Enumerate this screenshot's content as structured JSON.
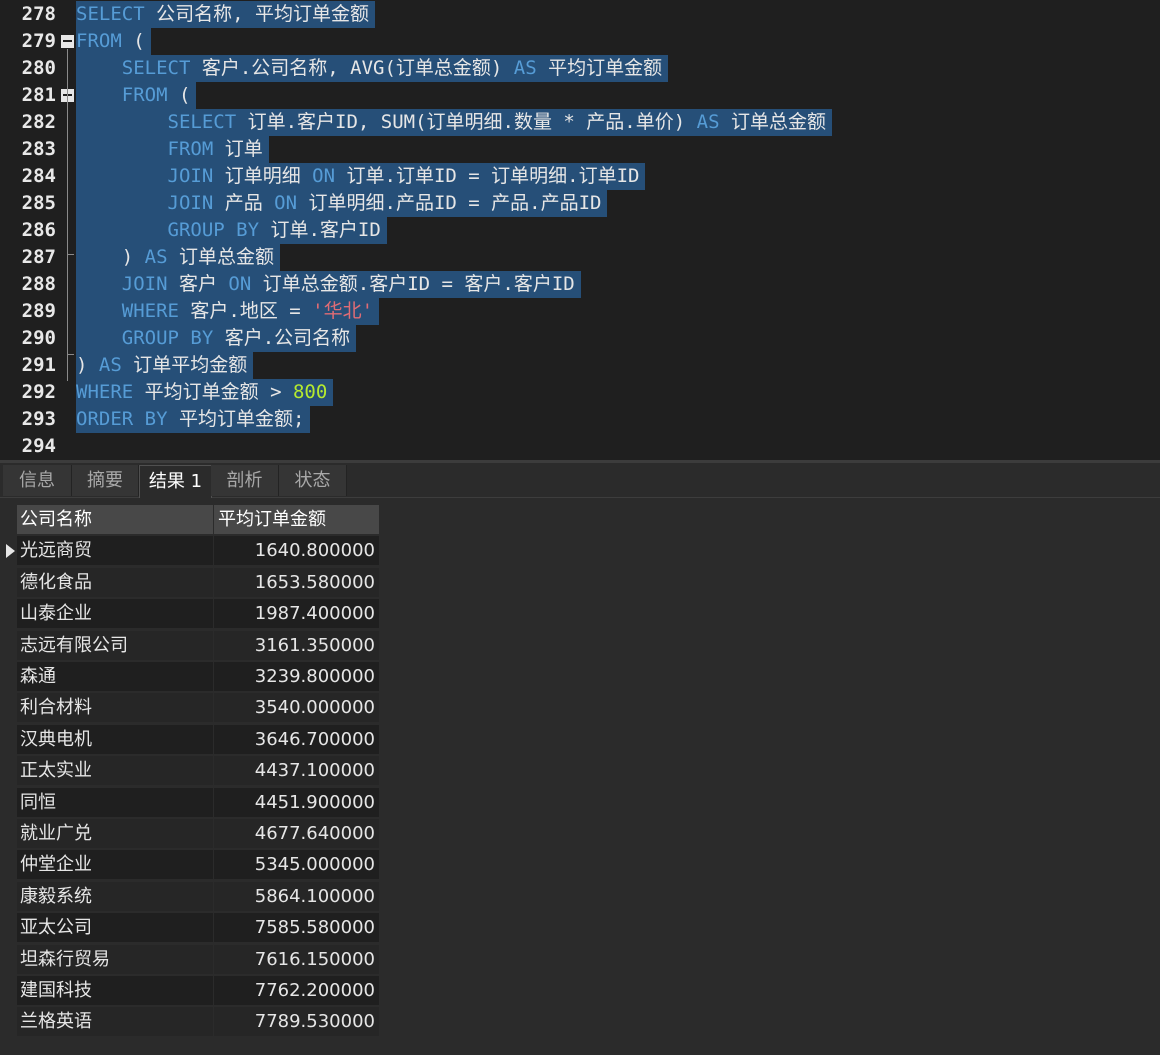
{
  "editor": {
    "lines": [
      {
        "num": "278",
        "tokens": [
          [
            "kw",
            "SELECT"
          ],
          [
            "t",
            " 公司名称, 平均订单金额"
          ]
        ]
      },
      {
        "num": "279",
        "tokens": [
          [
            "kw",
            "FROM"
          ],
          [
            "t",
            " ("
          ]
        ]
      },
      {
        "num": "280",
        "tokens": [
          [
            "t",
            "    "
          ],
          [
            "kw",
            "SELECT"
          ],
          [
            "t",
            " 客户.公司名称, AVG(订单总金额) "
          ],
          [
            "kw",
            "AS"
          ],
          [
            "t",
            " 平均订单金额"
          ]
        ]
      },
      {
        "num": "281",
        "tokens": [
          [
            "t",
            "    "
          ],
          [
            "kw",
            "FROM"
          ],
          [
            "t",
            " ("
          ]
        ]
      },
      {
        "num": "282",
        "tokens": [
          [
            "t",
            "        "
          ],
          [
            "kw",
            "SELECT"
          ],
          [
            "t",
            " 订单.客户ID, SUM(订单明细.数量 * 产品.单价) "
          ],
          [
            "kw",
            "AS"
          ],
          [
            "t",
            " 订单总金额"
          ]
        ]
      },
      {
        "num": "283",
        "tokens": [
          [
            "t",
            "        "
          ],
          [
            "kw",
            "FROM"
          ],
          [
            "t",
            " 订单"
          ]
        ]
      },
      {
        "num": "284",
        "tokens": [
          [
            "t",
            "        "
          ],
          [
            "kw",
            "JOIN"
          ],
          [
            "t",
            " 订单明细 "
          ],
          [
            "kw",
            "ON"
          ],
          [
            "t",
            " 订单.订单ID = 订单明细.订单ID"
          ]
        ]
      },
      {
        "num": "285",
        "tokens": [
          [
            "t",
            "        "
          ],
          [
            "kw",
            "JOIN"
          ],
          [
            "t",
            " 产品 "
          ],
          [
            "kw",
            "ON"
          ],
          [
            "t",
            " 订单明细.产品ID = 产品.产品ID"
          ]
        ]
      },
      {
        "num": "286",
        "tokens": [
          [
            "t",
            "        "
          ],
          [
            "kw",
            "GROUP BY"
          ],
          [
            "t",
            " 订单.客户ID"
          ]
        ]
      },
      {
        "num": "287",
        "tokens": [
          [
            "t",
            "    ) "
          ],
          [
            "kw",
            "AS"
          ],
          [
            "t",
            " 订单总金额"
          ]
        ]
      },
      {
        "num": "288",
        "tokens": [
          [
            "t",
            "    "
          ],
          [
            "kw",
            "JOIN"
          ],
          [
            "t",
            " 客户 "
          ],
          [
            "kw",
            "ON"
          ],
          [
            "t",
            " 订单总金额.客户ID = 客户.客户ID"
          ]
        ]
      },
      {
        "num": "289",
        "tokens": [
          [
            "t",
            "    "
          ],
          [
            "kw",
            "WHERE"
          ],
          [
            "t",
            " 客户.地区 = "
          ],
          [
            "str",
            "'华北'"
          ]
        ]
      },
      {
        "num": "290",
        "tokens": [
          [
            "t",
            "    "
          ],
          [
            "kw",
            "GROUP BY"
          ],
          [
            "t",
            " 客户.公司名称"
          ]
        ]
      },
      {
        "num": "291",
        "tokens": [
          [
            "t",
            ") "
          ],
          [
            "kw",
            "AS"
          ],
          [
            "t",
            " 订单平均金额"
          ]
        ]
      },
      {
        "num": "292",
        "tokens": [
          [
            "kw",
            "WHERE"
          ],
          [
            "t",
            " 平均订单金额 > "
          ],
          [
            "num",
            "800"
          ]
        ]
      },
      {
        "num": "293",
        "tokens": [
          [
            "kw",
            "ORDER BY"
          ],
          [
            "t",
            " 平均订单金额;"
          ]
        ]
      },
      {
        "num": "294",
        "tokens": []
      }
    ]
  },
  "tabs": [
    "信息",
    "摘要",
    "结果 1",
    "剖析",
    "状态"
  ],
  "active_tab": "结果 1",
  "results": {
    "columns": [
      "公司名称",
      "平均订单金额"
    ],
    "rows": [
      [
        "光远商贸",
        "1640.800000"
      ],
      [
        "德化食品",
        "1653.580000"
      ],
      [
        "山泰企业",
        "1987.400000"
      ],
      [
        "志远有限公司",
        "3161.350000"
      ],
      [
        "森通",
        "3239.800000"
      ],
      [
        "利合材料",
        "3540.000000"
      ],
      [
        "汉典电机",
        "3646.700000"
      ],
      [
        "正太实业",
        "4437.100000"
      ],
      [
        "同恒",
        "4451.900000"
      ],
      [
        "就业广兑",
        "4677.640000"
      ],
      [
        "仲堂企业",
        "5345.000000"
      ],
      [
        "康毅系统",
        "5864.100000"
      ],
      [
        "亚太公司",
        "7585.580000"
      ],
      [
        "坦森行贸易",
        "7616.150000"
      ],
      [
        "建国科技",
        "7762.200000"
      ],
      [
        "兰格英语",
        "7789.530000"
      ]
    ],
    "current_row": 0
  },
  "colors": {
    "editor_bg": "#1f1f1f",
    "selection": "#264f78",
    "keyword": "#569cd6",
    "string": "#e06c75",
    "number": "#b5ea2f",
    "grid_header": "#484848"
  }
}
